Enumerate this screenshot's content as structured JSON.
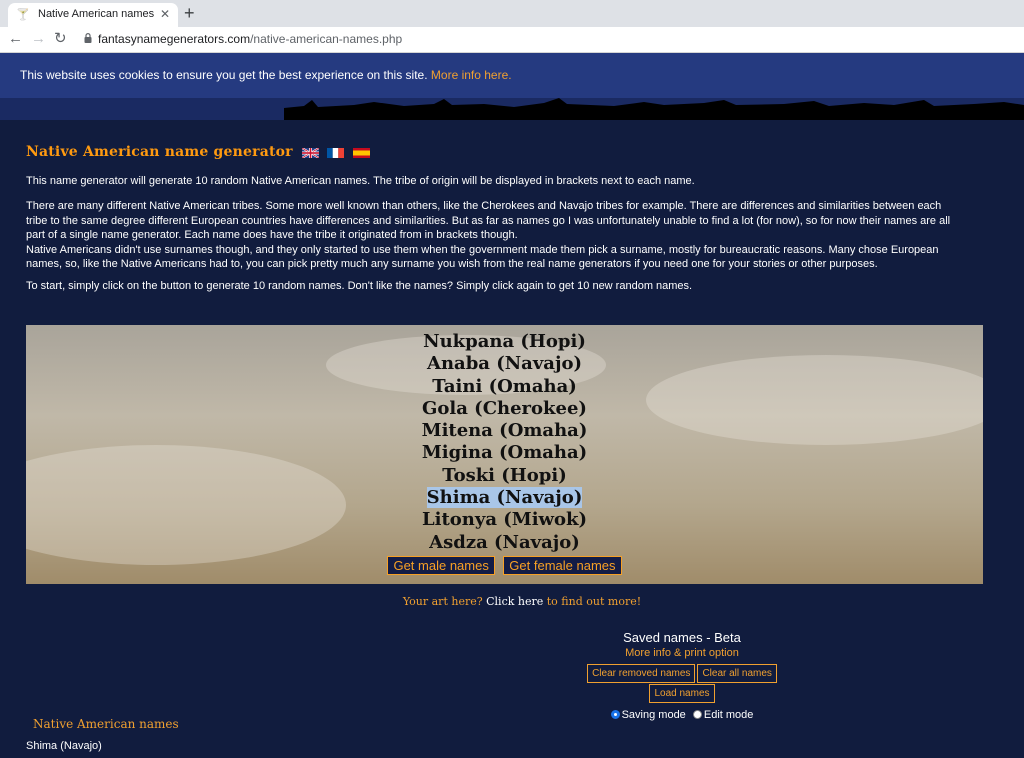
{
  "browser": {
    "tab_title": "Native American names",
    "tab_close": "✕",
    "new_tab": "+",
    "url_domain": "fantasynamegenerators.com",
    "url_path": "/native-american-names.php",
    "back": "←",
    "forward": "→",
    "reload": "↻"
  },
  "cookie": {
    "text": "This website uses cookies to ensure you get the best experience on this site. ",
    "link": "More info here."
  },
  "page": {
    "title": "Native American name generator",
    "flags": [
      "english-flag",
      "french-flag",
      "spanish-flag"
    ],
    "paragraph1": "This name generator will generate 10 random Native American names. The tribe of origin will be displayed in brackets next to each name.",
    "paragraph2_lines": [
      "There are many different Native American tribes. Some more well known than others, like the Cherokees and Navajo tribes for example. There are differences and similarities between each",
      "tribe to the same degree different European countries have differences and similarities. But as far as names go I was unfortunately unable to find a lot (for now), so for now their names are all",
      "part of a single name generator. Each name does have the tribe it originated from in brackets though.",
      "Native Americans didn't use surnames though, and they only started to use them when the government made them pick a surname, mostly for bureaucratic reasons. Many chose European",
      "names, so, like the Native Americans had to, you can pick pretty much any surname you wish from the real name generators if you need one for your stories or other purposes."
    ],
    "paragraph3": "To start, simply click on the button to generate 10 random names. Don't like the names? Simply click again to get 10 new random names."
  },
  "generator": {
    "names": [
      "Nukpana (Hopi)",
      "Anaba (Navajo)",
      "Taini (Omaha)",
      "Gola (Cherokee)",
      "Mitena (Omaha)",
      "Migina (Omaha)",
      "Toski (Hopi)",
      "Shima (Navajo)",
      "Litonya (Miwok)",
      "Asdza (Navajo)"
    ],
    "selected_index": 7,
    "male_button": "Get male names",
    "female_button": "Get female names"
  },
  "art": {
    "prefix": "Your art here? ",
    "link": "Click here",
    "suffix": " to find out more!"
  },
  "saved": {
    "title": "Saved names - Beta",
    "info": "More info & print option",
    "clear_removed": "Clear removed names",
    "clear_all": "Clear all names",
    "load": "Load names",
    "saving_mode": "Saving mode",
    "edit_mode": "Edit mode"
  },
  "list": {
    "title": "Native American names",
    "items": [
      "Shima (Navajo)"
    ]
  },
  "colors": {
    "page_bg": "#111c3e",
    "accent": "#f0a030",
    "cookie_bg": "#253a80"
  }
}
